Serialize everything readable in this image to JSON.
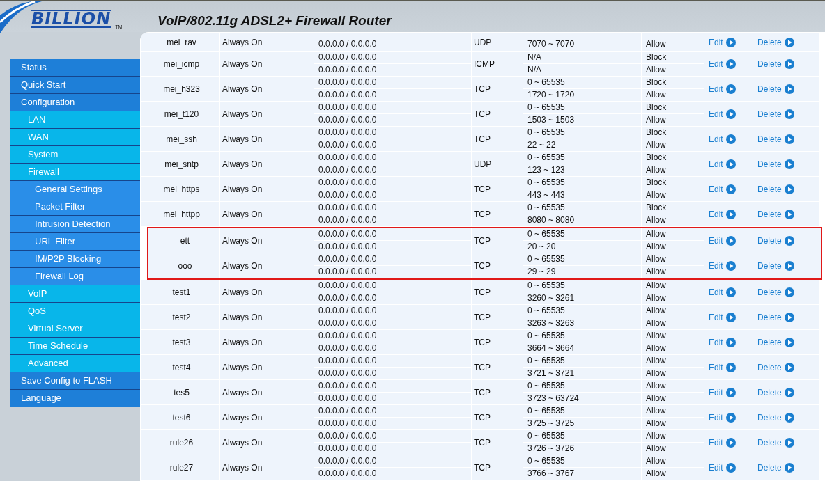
{
  "header": {
    "logo": "BILLION",
    "trademark": "TM",
    "title": "VoIP/802.11g ADSL2+ Firewall Router"
  },
  "sidebar": {
    "items": [
      {
        "label": "Status",
        "selected": false
      },
      {
        "label": "Quick Start",
        "selected": false
      },
      {
        "label": "Configuration",
        "selected": false,
        "children": [
          {
            "label": "LAN",
            "selected": false
          },
          {
            "label": "WAN",
            "selected": false
          },
          {
            "label": "System",
            "selected": false
          },
          {
            "label": "Firewall",
            "selected": false,
            "children": [
              {
                "label": "General Settings",
                "selected": false
              },
              {
                "label": "Packet Filter",
                "selected": false
              },
              {
                "label": "Intrusion Detection",
                "selected": false
              },
              {
                "label": "URL Filter",
                "selected": false
              },
              {
                "label": "IM/P2P Blocking",
                "selected": false
              },
              {
                "label": "Firewall Log",
                "selected": false
              }
            ]
          },
          {
            "label": "VoIP",
            "selected": false
          },
          {
            "label": "QoS",
            "selected": false
          },
          {
            "label": "Virtual Server",
            "selected": false
          },
          {
            "label": "Time Schedule",
            "selected": false
          },
          {
            "label": "Advanced",
            "selected": false
          }
        ]
      },
      {
        "label": "Save Config to FLASH",
        "selected": false
      },
      {
        "label": "Language",
        "selected": false
      }
    ]
  },
  "table": {
    "rows": [
      {
        "name": "mei_rav",
        "schedule": "Always On",
        "protocol": "UDP",
        "highlighted": false,
        "edit_label": "Edit",
        "delete_label": "Delete",
        "lines": [
          {
            "ip": "0.0.0.0 / 0.0.0.0",
            "port": "7070 ~ 7070",
            "action": "Allow"
          }
        ]
      },
      {
        "name": "mei_icmp",
        "schedule": "Always On",
        "protocol": "ICMP",
        "highlighted": false,
        "edit_label": "Edit",
        "delete_label": "Delete",
        "lines": [
          {
            "ip": "0.0.0.0 / 0.0.0.0",
            "port": "N/A",
            "action": "Block"
          },
          {
            "ip": "0.0.0.0 / 0.0.0.0",
            "port": "N/A",
            "action": "Allow"
          }
        ]
      },
      {
        "name": "mei_h323",
        "schedule": "Always On",
        "protocol": "TCP",
        "highlighted": false,
        "edit_label": "Edit",
        "delete_label": "Delete",
        "lines": [
          {
            "ip": "0.0.0.0 / 0.0.0.0",
            "port": "0 ~ 65535",
            "action": "Block"
          },
          {
            "ip": "0.0.0.0 / 0.0.0.0",
            "port": "1720 ~ 1720",
            "action": "Allow"
          }
        ]
      },
      {
        "name": "mei_t120",
        "schedule": "Always On",
        "protocol": "TCP",
        "highlighted": false,
        "edit_label": "Edit",
        "delete_label": "Delete",
        "lines": [
          {
            "ip": "0.0.0.0 / 0.0.0.0",
            "port": "0 ~ 65535",
            "action": "Block"
          },
          {
            "ip": "0.0.0.0 / 0.0.0.0",
            "port": "1503 ~ 1503",
            "action": "Allow"
          }
        ]
      },
      {
        "name": "mei_ssh",
        "schedule": "Always On",
        "protocol": "TCP",
        "highlighted": false,
        "edit_label": "Edit",
        "delete_label": "Delete",
        "lines": [
          {
            "ip": "0.0.0.0 / 0.0.0.0",
            "port": "0 ~ 65535",
            "action": "Block"
          },
          {
            "ip": "0.0.0.0 / 0.0.0.0",
            "port": "22 ~ 22",
            "action": "Allow"
          }
        ]
      },
      {
        "name": "mei_sntp",
        "schedule": "Always On",
        "protocol": "UDP",
        "highlighted": false,
        "edit_label": "Edit",
        "delete_label": "Delete",
        "lines": [
          {
            "ip": "0.0.0.0 / 0.0.0.0",
            "port": "0 ~ 65535",
            "action": "Block"
          },
          {
            "ip": "0.0.0.0 / 0.0.0.0",
            "port": "123 ~ 123",
            "action": "Allow"
          }
        ]
      },
      {
        "name": "mei_https",
        "schedule": "Always On",
        "protocol": "TCP",
        "highlighted": false,
        "edit_label": "Edit",
        "delete_label": "Delete",
        "lines": [
          {
            "ip": "0.0.0.0 / 0.0.0.0",
            "port": "0 ~ 65535",
            "action": "Block"
          },
          {
            "ip": "0.0.0.0 / 0.0.0.0",
            "port": "443 ~ 443",
            "action": "Allow"
          }
        ]
      },
      {
        "name": "mei_httpp",
        "schedule": "Always On",
        "protocol": "TCP",
        "highlighted": false,
        "edit_label": "Edit",
        "delete_label": "Delete",
        "lines": [
          {
            "ip": "0.0.0.0 / 0.0.0.0",
            "port": "0 ~ 65535",
            "action": "Block"
          },
          {
            "ip": "0.0.0.0 / 0.0.0.0",
            "port": "8080 ~ 8080",
            "action": "Allow"
          }
        ]
      },
      {
        "name": "ett",
        "schedule": "Always On",
        "protocol": "TCP",
        "highlighted": true,
        "edit_label": "Edit",
        "delete_label": "Delete",
        "lines": [
          {
            "ip": "0.0.0.0 / 0.0.0.0",
            "port": "0 ~ 65535",
            "action": "Allow"
          },
          {
            "ip": "0.0.0.0 / 0.0.0.0",
            "port": "20 ~ 20",
            "action": "Allow"
          }
        ]
      },
      {
        "name": "ooo",
        "schedule": "Always On",
        "protocol": "TCP",
        "highlighted": true,
        "edit_label": "Edit",
        "delete_label": "Delete",
        "lines": [
          {
            "ip": "0.0.0.0 / 0.0.0.0",
            "port": "0 ~ 65535",
            "action": "Allow"
          },
          {
            "ip": "0.0.0.0 / 0.0.0.0",
            "port": "29 ~ 29",
            "action": "Allow"
          }
        ]
      },
      {
        "name": "test1",
        "schedule": "Always On",
        "protocol": "TCP",
        "highlighted": false,
        "edit_label": "Edit",
        "delete_label": "Delete",
        "lines": [
          {
            "ip": "0.0.0.0 / 0.0.0.0",
            "port": "0 ~ 65535",
            "action": "Allow"
          },
          {
            "ip": "0.0.0.0 / 0.0.0.0",
            "port": "3260 ~ 3261",
            "action": "Allow"
          }
        ]
      },
      {
        "name": "test2",
        "schedule": "Always On",
        "protocol": "TCP",
        "highlighted": false,
        "edit_label": "Edit",
        "delete_label": "Delete",
        "lines": [
          {
            "ip": "0.0.0.0 / 0.0.0.0",
            "port": "0 ~ 65535",
            "action": "Allow"
          },
          {
            "ip": "0.0.0.0 / 0.0.0.0",
            "port": "3263 ~ 3263",
            "action": "Allow"
          }
        ]
      },
      {
        "name": "test3",
        "schedule": "Always On",
        "protocol": "TCP",
        "highlighted": false,
        "edit_label": "Edit",
        "delete_label": "Delete",
        "lines": [
          {
            "ip": "0.0.0.0 / 0.0.0.0",
            "port": "0 ~ 65535",
            "action": "Allow"
          },
          {
            "ip": "0.0.0.0 / 0.0.0.0",
            "port": "3664 ~ 3664",
            "action": "Allow"
          }
        ]
      },
      {
        "name": "test4",
        "schedule": "Always On",
        "protocol": "TCP",
        "highlighted": false,
        "edit_label": "Edit",
        "delete_label": "Delete",
        "lines": [
          {
            "ip": "0.0.0.0 / 0.0.0.0",
            "port": "0 ~ 65535",
            "action": "Allow"
          },
          {
            "ip": "0.0.0.0 / 0.0.0.0",
            "port": "3721 ~ 3721",
            "action": "Allow"
          }
        ]
      },
      {
        "name": "tes5",
        "schedule": "Always On",
        "protocol": "TCP",
        "highlighted": false,
        "edit_label": "Edit",
        "delete_label": "Delete",
        "lines": [
          {
            "ip": "0.0.0.0 / 0.0.0.0",
            "port": "0 ~ 65535",
            "action": "Allow"
          },
          {
            "ip": "0.0.0.0 / 0.0.0.0",
            "port": "3723 ~ 63724",
            "action": "Allow"
          }
        ]
      },
      {
        "name": "test6",
        "schedule": "Always On",
        "protocol": "TCP",
        "highlighted": false,
        "edit_label": "Edit",
        "delete_label": "Delete",
        "lines": [
          {
            "ip": "0.0.0.0 / 0.0.0.0",
            "port": "0 ~ 65535",
            "action": "Allow"
          },
          {
            "ip": "0.0.0.0 / 0.0.0.0",
            "port": "3725 ~ 3725",
            "action": "Allow"
          }
        ]
      },
      {
        "name": "rule26",
        "schedule": "Always On",
        "protocol": "TCP",
        "highlighted": false,
        "edit_label": "Edit",
        "delete_label": "Delete",
        "lines": [
          {
            "ip": "0.0.0.0 / 0.0.0.0",
            "port": "0 ~ 65535",
            "action": "Allow"
          },
          {
            "ip": "0.0.0.0 / 0.0.0.0",
            "port": "3726 ~ 3726",
            "action": "Allow"
          }
        ]
      },
      {
        "name": "rule27",
        "schedule": "Always On",
        "protocol": "TCP",
        "highlighted": false,
        "edit_label": "Edit",
        "delete_label": "Delete",
        "lines": [
          {
            "ip": "0.0.0.0 / 0.0.0.0",
            "port": "0 ~ 65535",
            "action": "Allow"
          },
          {
            "ip": "0.0.0.0 / 0.0.0.0",
            "port": "3766 ~ 3767",
            "action": "Allow"
          }
        ]
      }
    ]
  }
}
